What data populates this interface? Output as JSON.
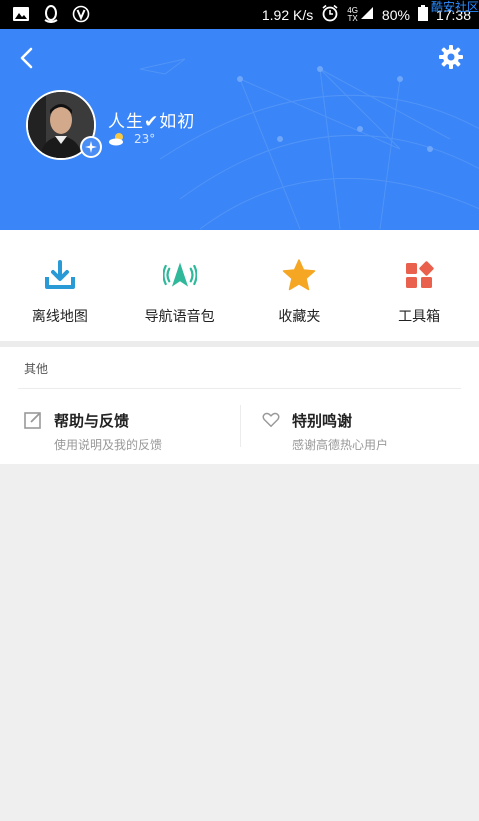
{
  "status_bar": {
    "speed": "1.92 K/s",
    "net_top": "4G",
    "net_bottom": "TX",
    "battery": "80%",
    "time": "17:38",
    "watermark": "酷安社区"
  },
  "profile": {
    "username": "人生✔如初",
    "temperature": "23°"
  },
  "tools": [
    {
      "label": "离线地图",
      "icon": "download-icon",
      "color": "#2a9ad6"
    },
    {
      "label": "导航语音包",
      "icon": "voice-nav-icon",
      "color": "#2fb89a"
    },
    {
      "label": "收藏夹",
      "icon": "star-icon",
      "color": "#f5a623"
    },
    {
      "label": "工具箱",
      "icon": "toolbox-icon",
      "color": "#e9604c"
    }
  ],
  "other": {
    "title": "其他",
    "help": {
      "title": "帮助与反馈",
      "subtitle": "使用说明及我的反馈"
    },
    "thanks": {
      "title": "特别鸣谢",
      "subtitle": "感谢高德热心用户"
    }
  },
  "colors": {
    "header_blue": "#3a85f7",
    "background": "#efefef"
  }
}
